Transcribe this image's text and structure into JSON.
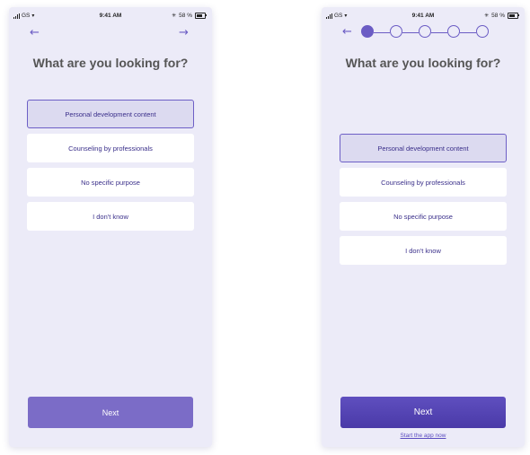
{
  "status": {
    "carrier": "GS",
    "time": "9:41 AM",
    "battery": "58 %"
  },
  "question": "What are you looking for?",
  "options": [
    {
      "label": "Personal development content",
      "selected": true
    },
    {
      "label": "Counseling by professionals",
      "selected": false
    },
    {
      "label": "No specific purpose",
      "selected": false
    },
    {
      "label": "I don't know",
      "selected": false
    }
  ],
  "next_label": "Next",
  "start_link": "Start the app now",
  "progress": {
    "steps": 5,
    "current": 1
  },
  "colors": {
    "accent": "#6b5cc4",
    "screen_bg": "#ecebf8",
    "button_left": "#7b6cc7",
    "button_right": "#4a3aa8"
  },
  "icons": {
    "back": "arrow-left-icon",
    "forward": "arrow-right-icon"
  }
}
